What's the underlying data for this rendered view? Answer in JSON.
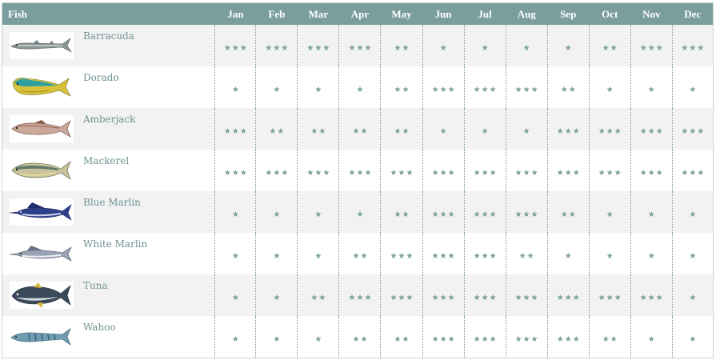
{
  "header": {
    "fish": "Fish",
    "months": [
      "Jan",
      "Feb",
      "Mar",
      "Apr",
      "May",
      "Jun",
      "Jul",
      "Aug",
      "Sep",
      "Oct",
      "Nov",
      "Dec"
    ]
  },
  "colors": {
    "header_background": "#7a9d9e",
    "header_text": "#ffffff",
    "star": "#7a9d9e",
    "fish_name": "#6f9192",
    "row_alt": "#f2f2f2"
  },
  "rating_icon": "star-icon",
  "fish": [
    {
      "name": "Barracuda",
      "icon": "barracuda-image",
      "ratings": [
        3,
        3,
        3,
        3,
        2,
        1,
        1,
        1,
        1,
        2,
        3,
        3
      ]
    },
    {
      "name": "Dorado",
      "icon": "dorado-image",
      "ratings": [
        1,
        1,
        1,
        1,
        2,
        3,
        3,
        3,
        2,
        1,
        1,
        1
      ]
    },
    {
      "name": "Amberjack",
      "icon": "amberjack-image",
      "ratings": [
        3,
        2,
        2,
        2,
        2,
        1,
        1,
        1,
        3,
        3,
        3,
        3
      ]
    },
    {
      "name": "Mackerel",
      "icon": "mackerel-image",
      "ratings": [
        3,
        3,
        3,
        3,
        3,
        3,
        3,
        3,
        3,
        3,
        3,
        3
      ]
    },
    {
      "name": "Blue Marlin",
      "icon": "blue-marlin-image",
      "ratings": [
        1,
        1,
        1,
        1,
        2,
        3,
        3,
        3,
        2,
        1,
        1,
        1
      ]
    },
    {
      "name": "White Marlin",
      "icon": "white-marlin-image",
      "ratings": [
        1,
        1,
        1,
        2,
        3,
        3,
        3,
        2,
        1,
        1,
        1,
        1
      ]
    },
    {
      "name": "Tuna",
      "icon": "tuna-image",
      "ratings": [
        1,
        1,
        2,
        3,
        3,
        3,
        3,
        3,
        3,
        3,
        3,
        1
      ]
    },
    {
      "name": "Wahoo",
      "icon": "wahoo-image",
      "ratings": [
        1,
        1,
        1,
        2,
        2,
        3,
        3,
        3,
        3,
        2,
        1,
        1
      ]
    }
  ]
}
